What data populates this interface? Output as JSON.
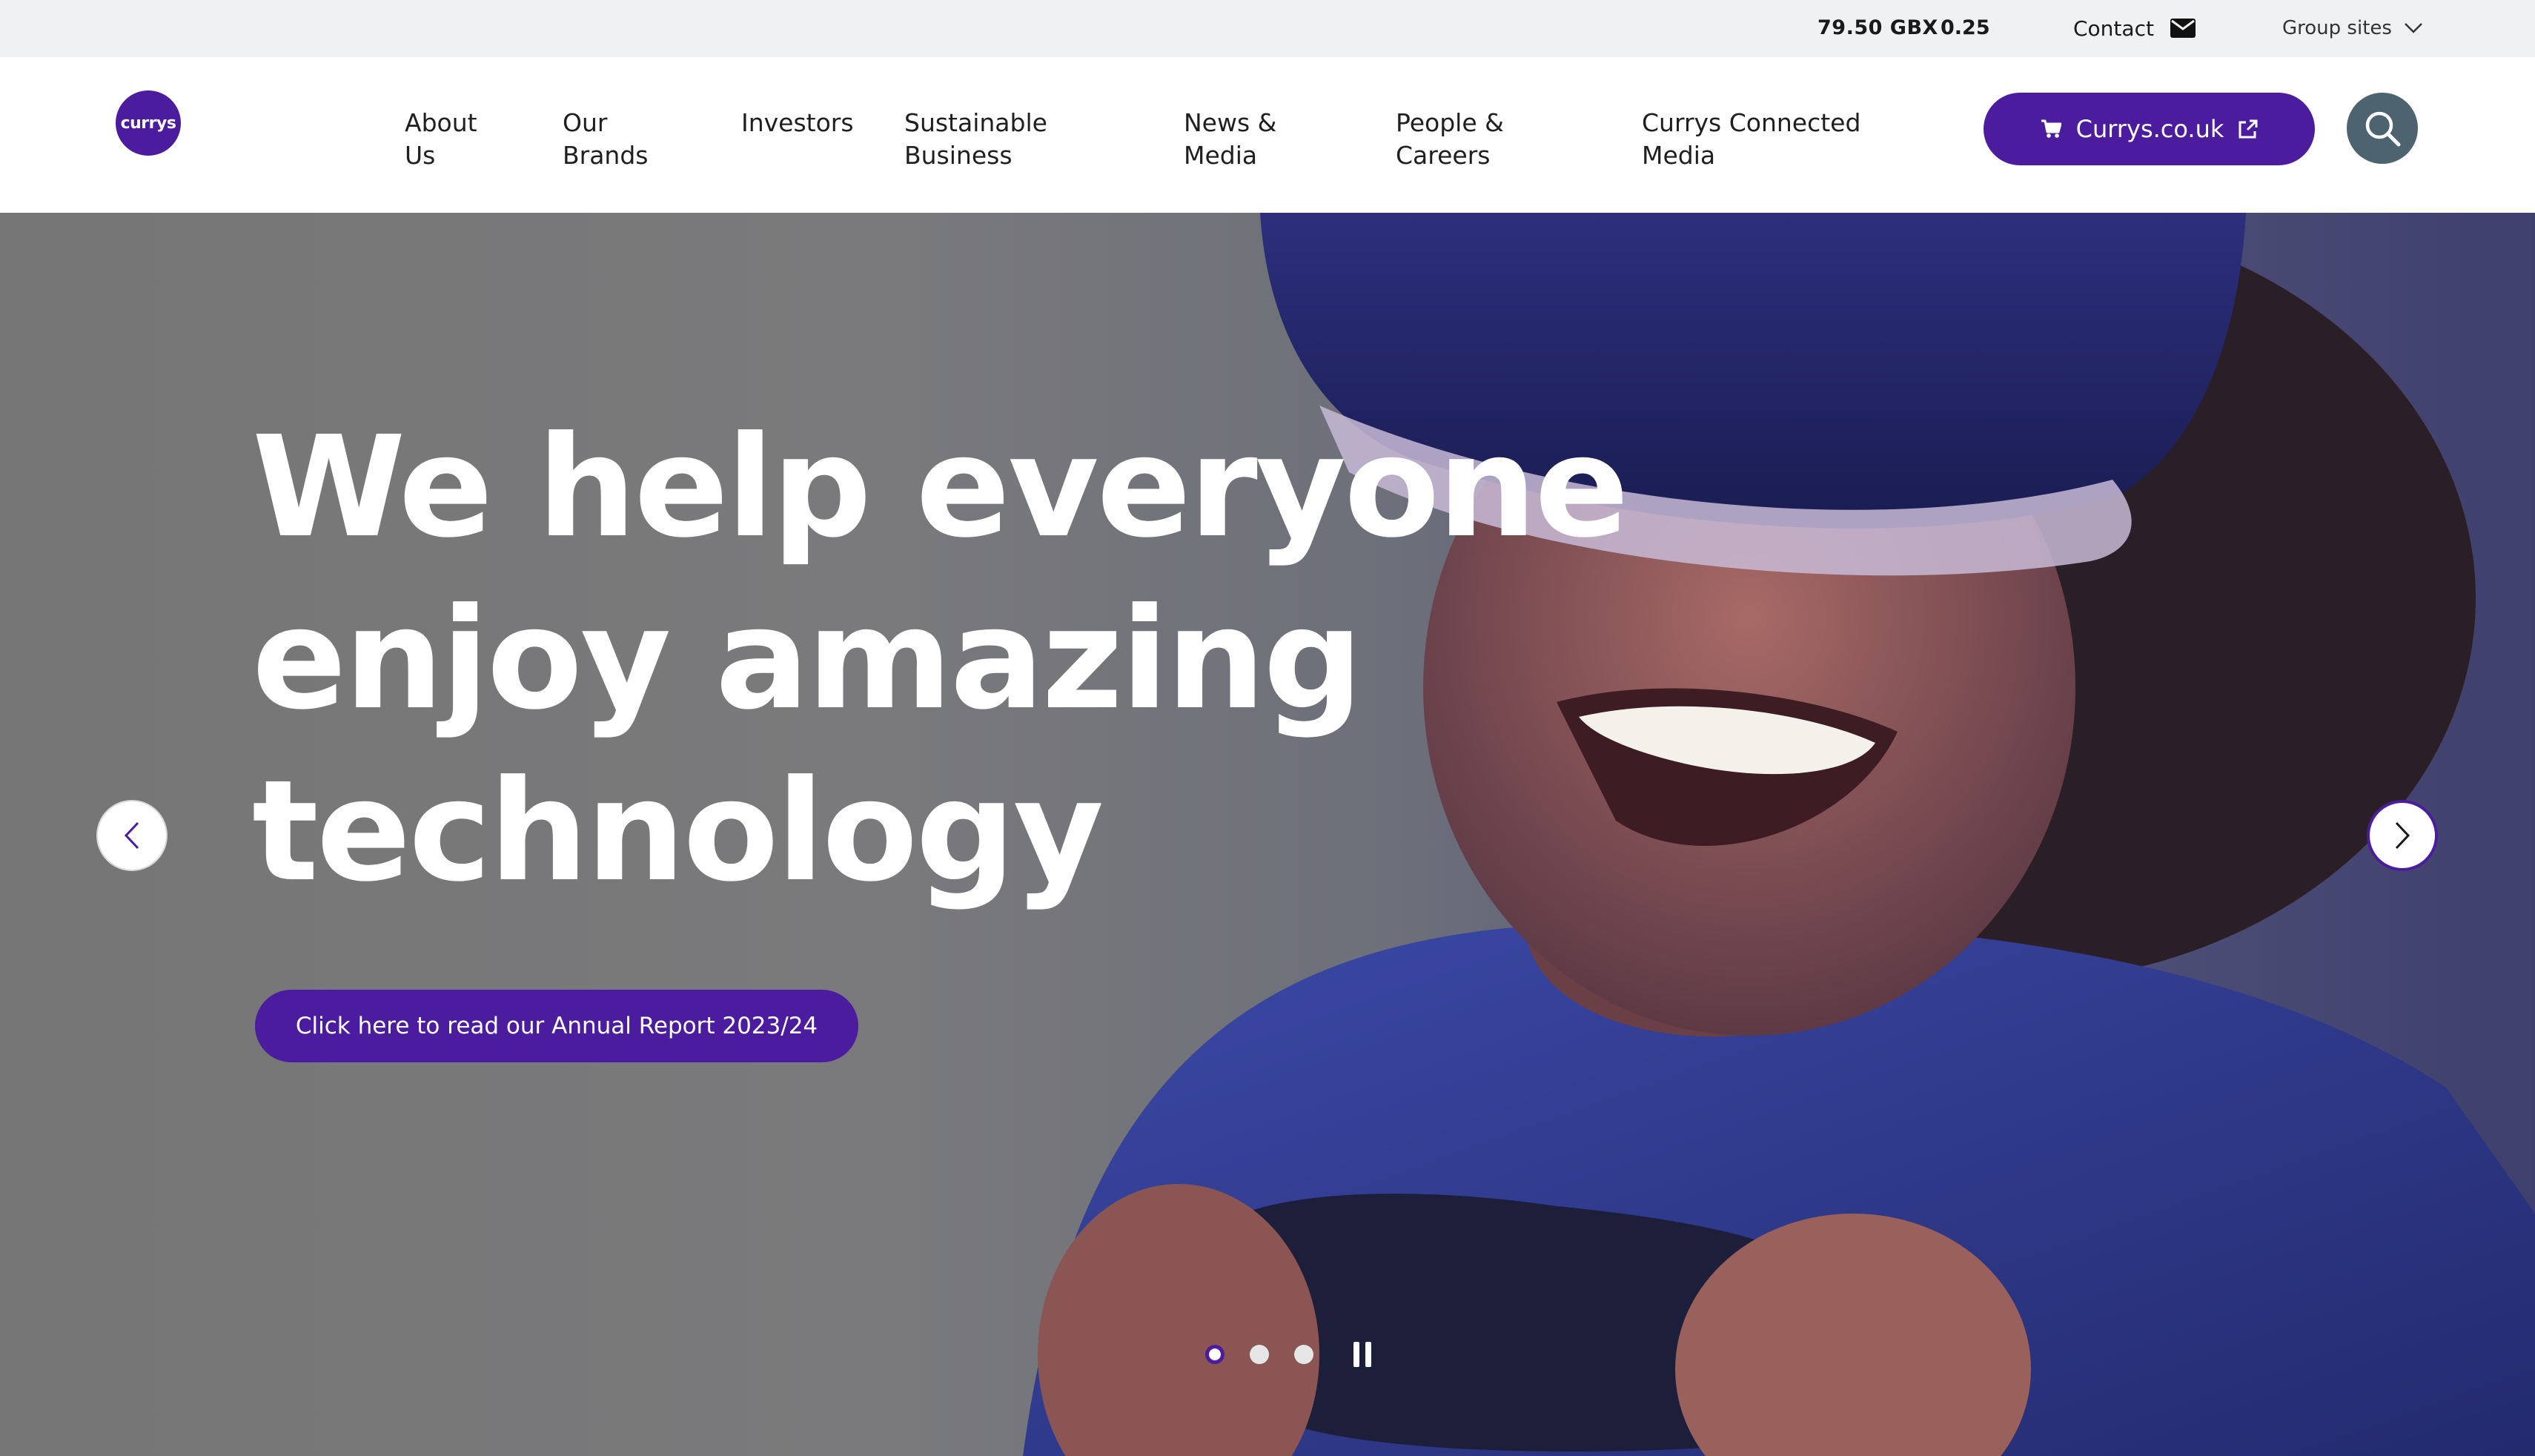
{
  "utility_bar": {
    "share_price": "79.50 GBX",
    "change": "0.25",
    "contact_label": "Contact",
    "contact_icon": "mail-icon",
    "group_sites_label": "Group sites",
    "group_sites_icon": "chevron-down-icon"
  },
  "header": {
    "logo_text": "currys",
    "nav": [
      {
        "label": "About\nUs"
      },
      {
        "label": "Our\nBrands"
      },
      {
        "label": "Investors"
      },
      {
        "label": "Sustainable\nBusiness"
      },
      {
        "label": "News &\nMedia"
      },
      {
        "label": "People &\nCareers"
      },
      {
        "label": "Currys Connected\nMedia"
      }
    ],
    "shop_button": {
      "label": "Currys.co.uk",
      "icon_left": "cart-icon",
      "icon_right": "external-link-icon"
    },
    "search_icon": "search-icon"
  },
  "hero": {
    "headline": [
      "We help everyone",
      "enjoy amazing",
      "technology"
    ],
    "cta_label": "Click here to read our Annual Report 2023/24",
    "slides": {
      "count": 3,
      "active_index": 0
    },
    "prev_icon": "chevron-left-icon",
    "next_icon": "chevron-right-icon",
    "pause_icon": "pause-icon"
  },
  "colors": {
    "brand_purple": "#4c1c9e",
    "search_button": "#4d6470",
    "utility_bg": "#f0f1f3",
    "hero_text": "#ffffff"
  }
}
